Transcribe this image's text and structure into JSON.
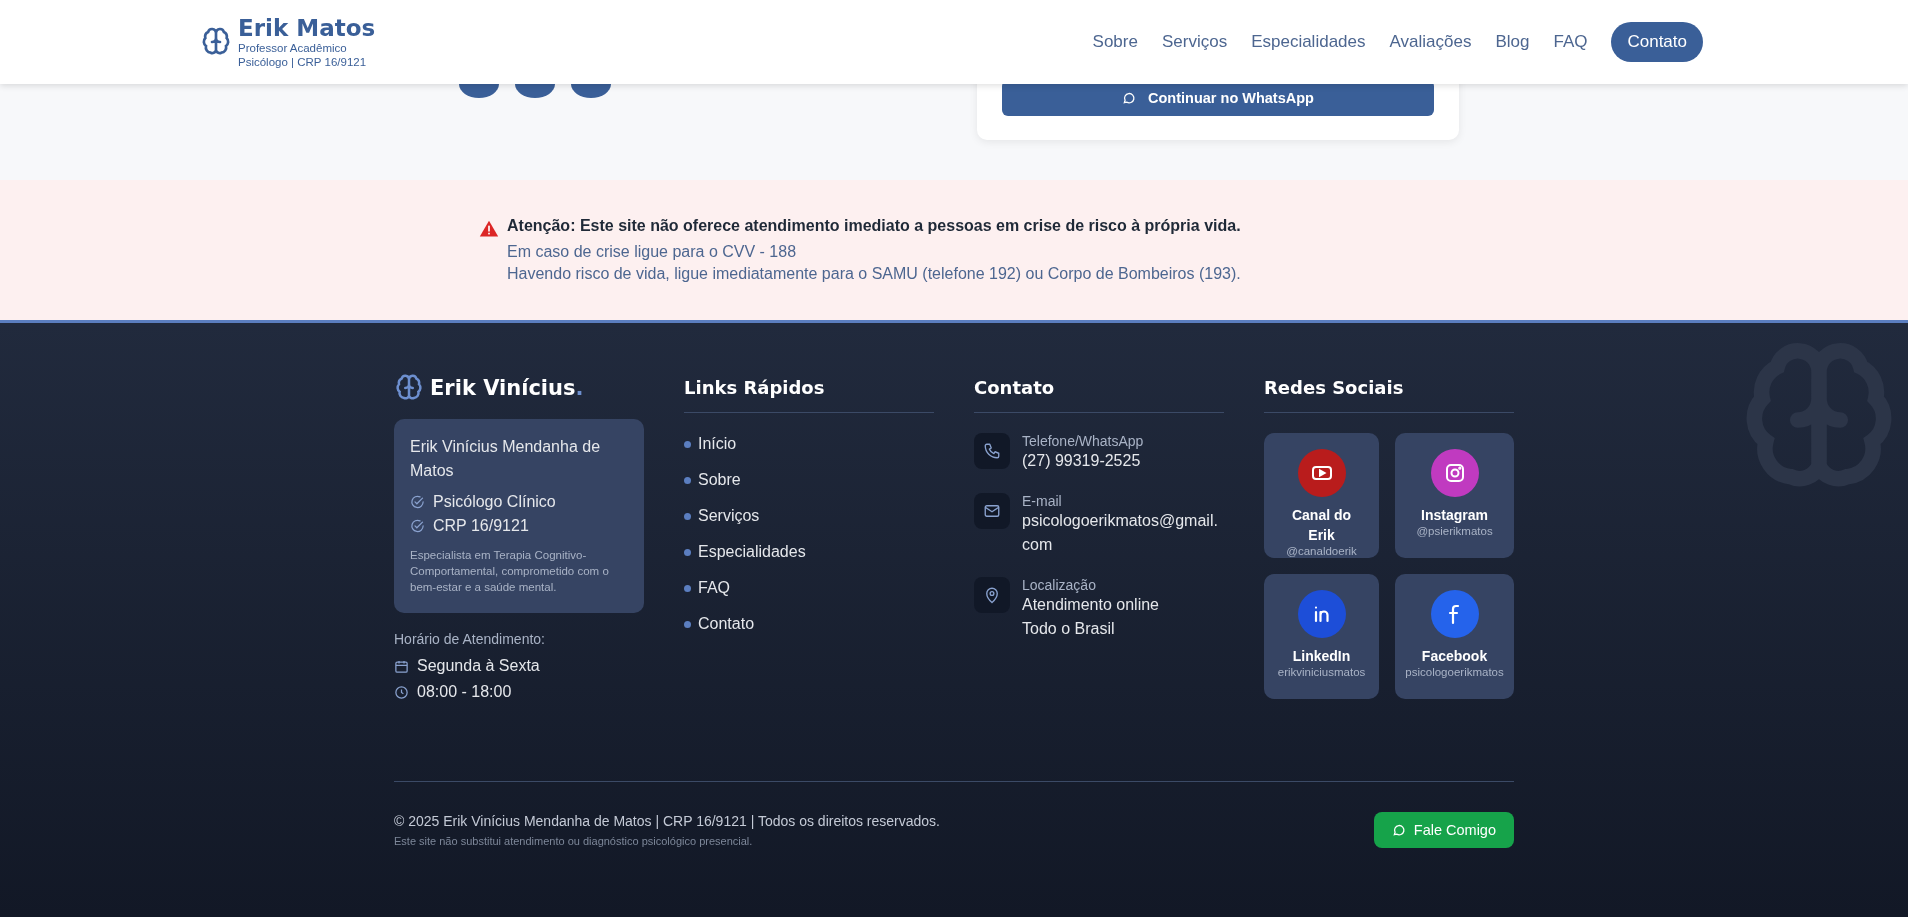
{
  "header": {
    "brand": "Erik Matos",
    "subtitle": [
      "Professor Acadêmico",
      "Psicólogo | CRP 16/9121"
    ],
    "nav": [
      "Sobre",
      "Serviços",
      "Especialidades",
      "Avaliações",
      "Blog",
      "FAQ"
    ],
    "cta": "Contato"
  },
  "contact_section": {
    "whatsapp_button": "Continuar no WhatsApp"
  },
  "alert": {
    "title": "Atenção: Este site não oferece atendimento imediato a pessoas em crise de risco à própria vida.",
    "lines": [
      "Em caso de crise ligue para o CVV - 188",
      "Havendo risco de vida, ligue imediatamente para o SAMU (telefone 192) ou Corpo de Bombeiros (193)."
    ]
  },
  "footer": {
    "brand": "Erik Vinícius",
    "brand_mark": ".",
    "profile": {
      "name": "Erik Vinícius Mendanha de Matos",
      "badges": [
        "Psicólogo Clínico",
        "CRP 16/9121"
      ],
      "description": "Especialista em Terapia Cognitivo-Comportamental, comprometido com o bem-estar e a saúde mental."
    },
    "hours_label": "Horário de Atendimento:",
    "hours": [
      {
        "kind": "days",
        "text": "Segunda à Sexta"
      },
      {
        "kind": "time",
        "text": "08:00 - 18:00"
      }
    ],
    "links_title": "Links Rápidos",
    "links": [
      "Início",
      "Sobre",
      "Serviços",
      "Especialidades",
      "FAQ",
      "Contato"
    ],
    "contact_title": "Contato",
    "contacts": [
      {
        "kind": "phone",
        "label": "Telefone/WhatsApp",
        "values": [
          "(27) 99319-2525"
        ]
      },
      {
        "kind": "email",
        "label": "E-mail",
        "values": [
          "psicologoerikmatos@gmail.com"
        ]
      },
      {
        "kind": "location",
        "label": "Localização",
        "values": [
          "Atendimento online",
          "Todo o Brasil"
        ]
      }
    ],
    "social_title": "Redes Sociais",
    "socials": [
      {
        "kind": "youtube",
        "name": "Canal do Erik",
        "handle": "@canaldoerik",
        "color": "#b91c1c"
      },
      {
        "kind": "instagram",
        "name": "Instagram",
        "handle": "@psierikmatos",
        "color": "#c03ac0"
      },
      {
        "kind": "linkedin",
        "name": "LinkedIn",
        "handle": "erikviniciusmatos",
        "color": "#1d4ed8"
      },
      {
        "kind": "facebook",
        "name": "Facebook",
        "handle": "psicologoerikmatos",
        "color": "#2563eb"
      }
    ],
    "copyright": "© 2025 Erik Vinícius Mendanha de Matos | CRP 16/9121 | Todos os direitos reservados.",
    "disclaimer": "Este site não substitui atendimento ou diagnóstico psicológico presencial.",
    "cta": "Fale Comigo"
  }
}
